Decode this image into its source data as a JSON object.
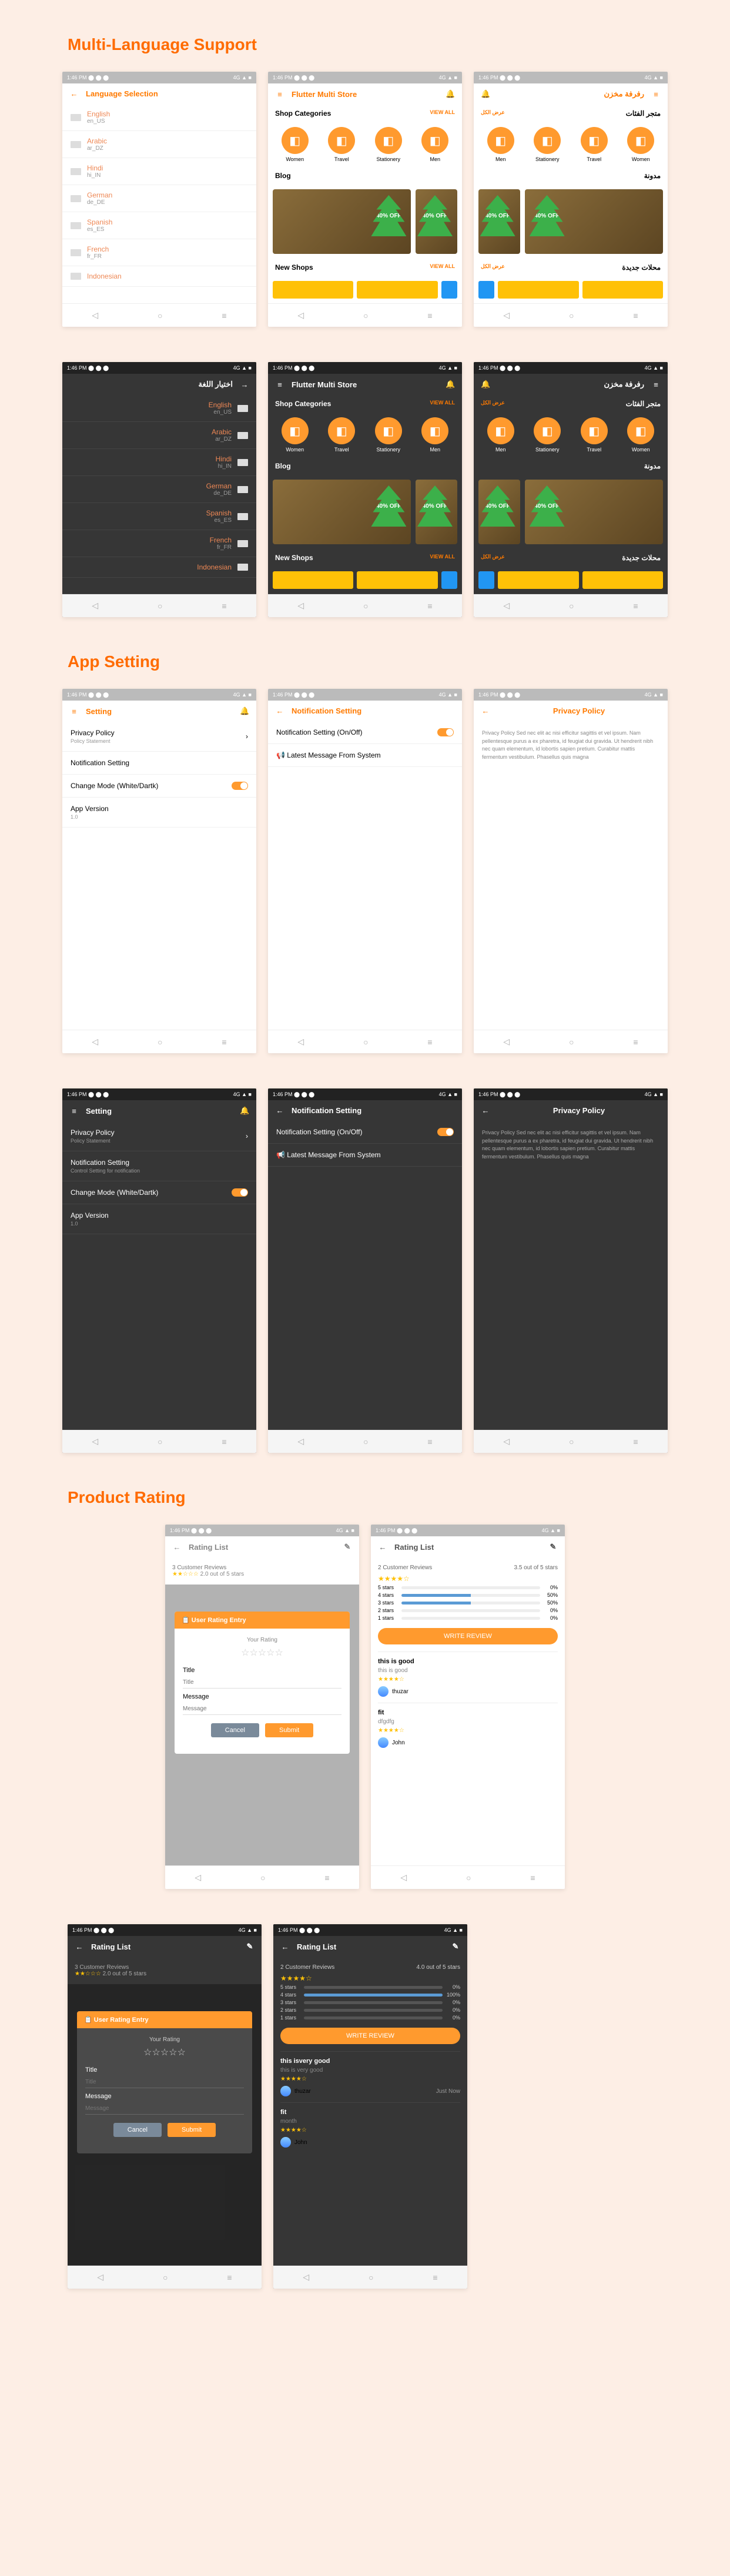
{
  "sections": {
    "multi": "Multi-Language Support",
    "app": "App Setting",
    "rating": "Product Rating"
  },
  "statusbar": {
    "left": "1:46 PM ⬤ ⬤ ⬤",
    "right": "4G ▲ ■"
  },
  "langSel": {
    "title": "Language Selection",
    "items": [
      {
        "name": "English",
        "code": "en_US"
      },
      {
        "name": "Arabic",
        "code": "ar_DZ"
      },
      {
        "name": "Hindi",
        "code": "hi_IN"
      },
      {
        "name": "German",
        "code": "de_DE"
      },
      {
        "name": "Spanish",
        "code": "es_ES"
      },
      {
        "name": "French",
        "code": "fr_FR"
      },
      {
        "name": "Indonesian",
        "code": ""
      }
    ],
    "titleAr": "اختيار اللغة"
  },
  "store": {
    "title": "Flutter Multi Store",
    "titleAr": "رفرفة مخزن",
    "shopCats": "Shop Categories",
    "shopCatsAr": "متجر الفئات",
    "viewAll": "VIEW ALL",
    "cats": [
      {
        "label": "Women"
      },
      {
        "label": "Travel"
      },
      {
        "label": "Stationery"
      },
      {
        "label": "Men"
      }
    ],
    "catsAr": [
      {
        "label": "Men"
      },
      {
        "label": "Stationery"
      },
      {
        "label": "Travel"
      },
      {
        "label": "Women"
      }
    ],
    "blog": "Blog",
    "blogAr": "مدونة",
    "offer": "40% OFF",
    "newShops": "New Shops",
    "newShopsAr": "محلات جديدة",
    "viewAllAr": "عرض الكل"
  },
  "setting": {
    "title": "Setting",
    "privacy": "Privacy Policy",
    "privacySub": "Policy Statement",
    "notif": "Notification Setting",
    "notifSub": "Control Setting for notification",
    "mode": "Change Mode (White/Dartk)",
    "version": "App Version",
    "versionNum": "1.0",
    "notifTitle": "Notification Setting",
    "notifOnOff": "Notification Setting (On/Off)",
    "latest": "Latest Message From System",
    "policyTitle": "Privacy Policy",
    "policyText": "Privacy Policy Sed nec elit ac nisi efficitur sagittis et vel ipsum. Nam pellentesque purus a ex pharetra, id feugiat dui gravida. Ut hendrerit nibh nec quam elementum, id lobortis sapien pretium. Curabitur mattis fermentum vestibulum. Phasellus quis magna"
  },
  "rating": {
    "title": "Rating List",
    "dialog": {
      "head": "User Rating Entry",
      "yourRating": "Your Rating",
      "titleLbl": "Title",
      "titlePh": "Title",
      "msgLbl": "Message",
      "msgPh": "Message",
      "cancel": "Cancel",
      "submit": "Submit"
    },
    "summary": {
      "count": "2 Customer Reviews",
      "avg": "3.5 out of 5 stars",
      "avg2": "4.0 out of 5 stars"
    },
    "bars": [
      {
        "l": "5 stars",
        "p": "0%",
        "w": 0
      },
      {
        "l": "4 stars",
        "p": "50%",
        "w": 50
      },
      {
        "l": "3 stars",
        "p": "50%",
        "w": 50
      },
      {
        "l": "2 stars",
        "p": "0%",
        "w": 0
      },
      {
        "l": "1 stars",
        "p": "0%",
        "w": 0
      }
    ],
    "bars2": [
      {
        "l": "5 stars",
        "p": "0%",
        "w": 0
      },
      {
        "l": "4 stars",
        "p": "100%",
        "w": 100
      },
      {
        "l": "3 stars",
        "p": "0%",
        "w": 0
      },
      {
        "l": "2 stars",
        "p": "0%",
        "w": 0
      },
      {
        "l": "1 stars",
        "p": "0%",
        "w": 0
      }
    ],
    "writeBtn": "WRITE REVIEW",
    "reviews": [
      {
        "title": "this is good",
        "text": "this is good",
        "user": "thuzar",
        "time": ""
      },
      {
        "title": "fit",
        "text": "dfgdfg",
        "user": "John",
        "time": ""
      }
    ],
    "reviews2": [
      {
        "title": "this isvery good",
        "text": "this is very good",
        "user": "thuzar",
        "time": "Just Now"
      },
      {
        "title": "fit",
        "text": "month",
        "user": "John",
        "time": ""
      }
    ],
    "bgReviews": "3 Customer Reviews",
    "bgAvg": "2.0 out of 5 stars"
  }
}
